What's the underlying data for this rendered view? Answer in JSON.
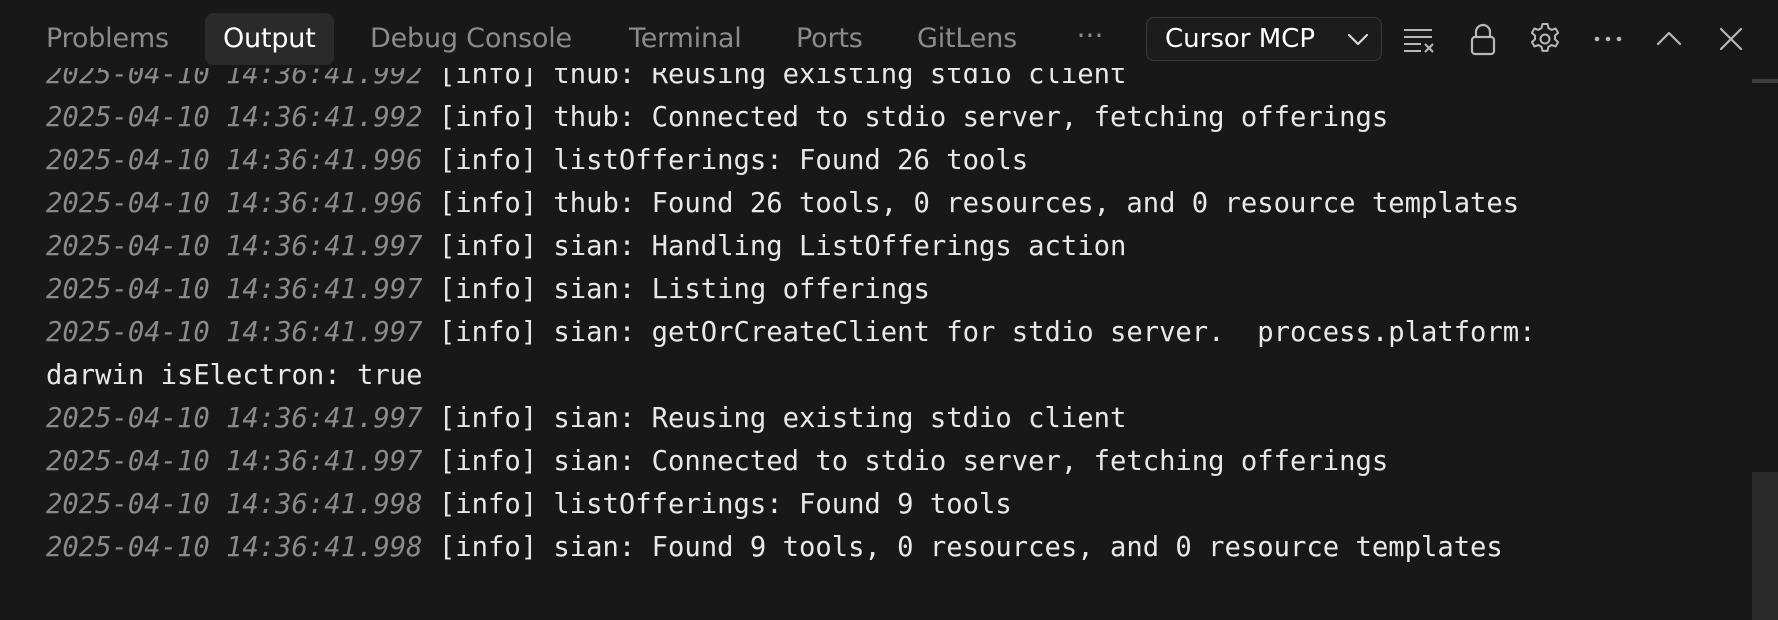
{
  "tabs": {
    "problems": "Problems",
    "output": "Output",
    "debug_console": "Debug Console",
    "terminal": "Terminal",
    "ports": "Ports",
    "gitlens": "GitLens",
    "more": "···",
    "active": "Output"
  },
  "channel": {
    "selected": "Cursor MCP"
  },
  "toolbar": {
    "icons": [
      "clear-output-icon",
      "lock-scroll-icon",
      "settings-gear-icon",
      "more-actions-icon",
      "maximize-panel-icon",
      "close-panel-icon"
    ]
  },
  "colors": {
    "background": "#181818",
    "tab_active_bg": "#2a2a2a",
    "timestamp": "#8a8a8a",
    "text": "#e8e8e8"
  },
  "log": {
    "lines": [
      {
        "ts": "2025-04-10 14:36:41.992",
        "msg": "[info] thub: Reusing existing stdio client"
      },
      {
        "ts": "2025-04-10 14:36:41.992",
        "msg": "[info] thub: Connected to stdio server, fetching offerings"
      },
      {
        "ts": "2025-04-10 14:36:41.996",
        "msg": "[info] listOfferings: Found 26 tools"
      },
      {
        "ts": "2025-04-10 14:36:41.996",
        "msg": "[info] thub: Found 26 tools, 0 resources, and 0 resource templates"
      },
      {
        "ts": "2025-04-10 14:36:41.997",
        "msg": "[info] sian: Handling ListOfferings action"
      },
      {
        "ts": "2025-04-10 14:36:41.997",
        "msg": "[info] sian: Listing offerings"
      },
      {
        "ts": "2025-04-10 14:36:41.997",
        "msg": "[info] sian: getOrCreateClient for stdio server.  process.platform:"
      },
      {
        "ts": "",
        "msg": "darwin isElectron: true"
      },
      {
        "ts": "2025-04-10 14:36:41.997",
        "msg": "[info] sian: Reusing existing stdio client"
      },
      {
        "ts": "2025-04-10 14:36:41.997",
        "msg": "[info] sian: Connected to stdio server, fetching offerings"
      },
      {
        "ts": "2025-04-10 14:36:41.998",
        "msg": "[info] listOfferings: Found 9 tools"
      },
      {
        "ts": "2025-04-10 14:36:41.998",
        "msg": "[info] sian: Found 9 tools, 0 resources, and 0 resource templates"
      }
    ]
  }
}
